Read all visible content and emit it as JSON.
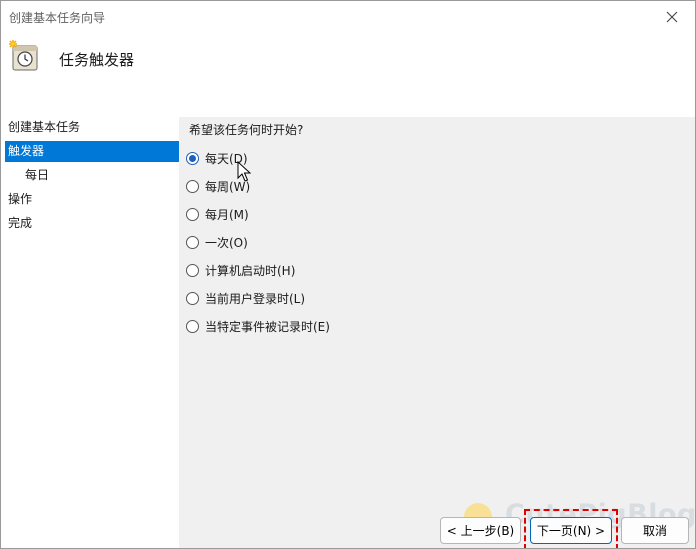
{
  "window": {
    "title": "创建基本任务向导",
    "close_icon": "close-icon"
  },
  "header": {
    "icon": "scheduled-task-icon",
    "title": "任务触发器"
  },
  "nav": {
    "items": [
      {
        "label": "创建基本任务",
        "selected": false
      },
      {
        "label": "触发器",
        "selected": true
      },
      {
        "label": "每日",
        "selected": false,
        "sub": true
      },
      {
        "label": "操作",
        "selected": false
      },
      {
        "label": "完成",
        "selected": false
      }
    ]
  },
  "content": {
    "question": "希望该任务何时开始?",
    "options": [
      {
        "label": "每天(D)",
        "checked": true
      },
      {
        "label": "每周(W)",
        "checked": false
      },
      {
        "label": "每月(M)",
        "checked": false
      },
      {
        "label": "一次(O)",
        "checked": false
      },
      {
        "label": "计算机启动时(H)",
        "checked": false
      },
      {
        "label": "当前用户登录时(L)",
        "checked": false
      },
      {
        "label": "当特定事件被记录时(E)",
        "checked": false
      }
    ]
  },
  "buttons": {
    "back": "< 上一步(B)",
    "next": "下一页(N) >",
    "cancel": "取消"
  },
  "watermark": {
    "text": "CutePigBlog"
  },
  "colors": {
    "selection": "#0078d7",
    "radio_checked": "#1f5fb8",
    "highlight": "#e00000"
  }
}
